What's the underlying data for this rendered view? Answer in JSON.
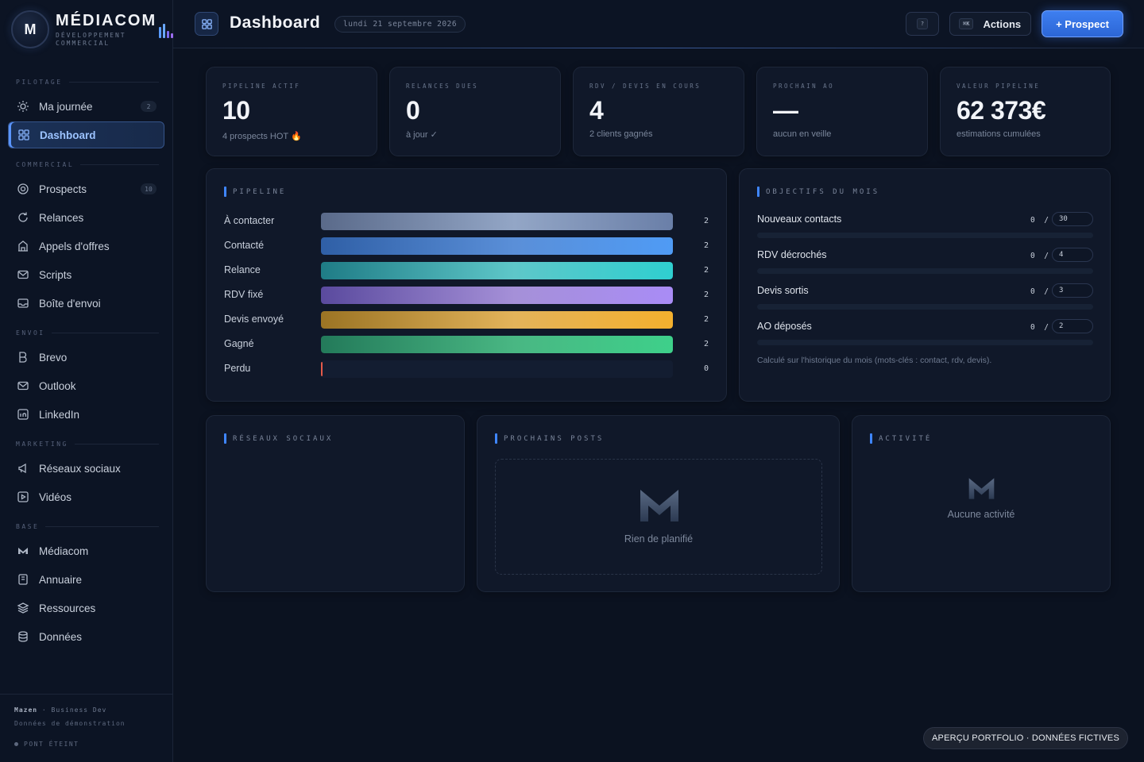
{
  "brand": {
    "logo_letter": "M",
    "name": "MÉDIACOM",
    "subtitle": "DÉVELOPPEMENT COMMERCIAL"
  },
  "sidebar": {
    "sections": [
      {
        "label": "PILOTAGE"
      },
      {
        "label": "COMMERCIAL"
      },
      {
        "label": "ENVOI"
      },
      {
        "label": "MARKETING"
      },
      {
        "label": "BASE"
      }
    ],
    "items": [
      {
        "label": "Ma journée",
        "icon": "sun-icon",
        "badge": "2"
      },
      {
        "label": "Dashboard",
        "icon": "grid-icon",
        "active": true
      },
      {
        "label": "Prospects",
        "icon": "target-icon",
        "badge": "10"
      },
      {
        "label": "Relances",
        "icon": "refresh-icon"
      },
      {
        "label": "Appels d'offres",
        "icon": "building-icon"
      },
      {
        "label": "Scripts",
        "icon": "mail-icon"
      },
      {
        "label": "Boîte d'envoi",
        "icon": "inbox-icon"
      },
      {
        "label": "Brevo",
        "icon": "brevo-icon"
      },
      {
        "label": "Outlook",
        "icon": "mail-icon"
      },
      {
        "label": "LinkedIn",
        "icon": "linkedin-icon"
      },
      {
        "label": "Réseaux sociaux",
        "icon": "megaphone-icon"
      },
      {
        "label": "Vidéos",
        "icon": "play-icon"
      },
      {
        "label": "Médiacom",
        "icon": "mediacom-icon"
      },
      {
        "label": "Annuaire",
        "icon": "book-icon"
      },
      {
        "label": "Ressources",
        "icon": "layers-icon"
      },
      {
        "label": "Données",
        "icon": "database-icon"
      }
    ],
    "footer": {
      "user": "Mazen",
      "role": "· Business Dev",
      "demo": "Données de démonstration",
      "status": "PONT ÉTEINT"
    }
  },
  "topbar": {
    "title": "Dashboard",
    "date": "lundi 21 septembre 2026",
    "help_key": "?",
    "actions_key": "⌘K",
    "actions_label": "Actions",
    "prospect_button": "+ Prospect"
  },
  "kpis": [
    {
      "label": "PIPELINE ACTIF",
      "value": "10",
      "sub": "4 prospects HOT 🔥"
    },
    {
      "label": "RELANCES DUES",
      "value": "0",
      "sub": "à jour ✓"
    },
    {
      "label": "RDV / DEVIS EN COURS",
      "value": "4",
      "sub": "2 clients gagnés"
    },
    {
      "label": "PROCHAIN AO",
      "value": "—",
      "sub": "aucun en veille"
    },
    {
      "label": "VALEUR PIPELINE",
      "value": "62 373€",
      "sub": "estimations cumulées"
    }
  ],
  "pipeline": {
    "title": "PIPELINE",
    "max": 2,
    "stages": [
      {
        "label": "À contacter",
        "count": 2,
        "color_from": "#5a6a8a",
        "color_mid": "#93a6c6",
        "color_to": "#6a7fa8"
      },
      {
        "label": "Contacté",
        "count": 2,
        "color_from": "#2f5fa6",
        "color_mid": "#5a8fd8",
        "color_to": "#4f9bf5"
      },
      {
        "label": "Relance",
        "count": 2,
        "color_from": "#1f7c86",
        "color_mid": "#5ec7c9",
        "color_to": "#2fcfd0"
      },
      {
        "label": "RDV fixé",
        "count": 2,
        "color_from": "#5a4a9e",
        "color_mid": "#a590d8",
        "color_to": "#a98cf6"
      },
      {
        "label": "Devis envoyé",
        "count": 2,
        "color_from": "#9b7424",
        "color_mid": "#e3b35a",
        "color_to": "#f4b02e"
      },
      {
        "label": "Gagné",
        "count": 2,
        "color_from": "#237a5a",
        "color_mid": "#49b783",
        "color_to": "#3ed08a"
      },
      {
        "label": "Perdu",
        "count": 0,
        "color_from": "#e55a4a",
        "color_mid": "#e55a4a",
        "color_to": "#e55a4a"
      }
    ]
  },
  "objectives": {
    "title": "OBJECTIFS DU MOIS",
    "items": [
      {
        "label": "Nouveaux contacts",
        "current": "0",
        "sep": "/",
        "target": "30",
        "progress": 0
      },
      {
        "label": "RDV décrochés",
        "current": "0",
        "sep": "/",
        "target": "4",
        "progress": 0
      },
      {
        "label": "Devis sortis",
        "current": "0",
        "sep": "/",
        "target": "3",
        "progress": 0
      },
      {
        "label": "AO déposés",
        "current": "0",
        "sep": "/",
        "target": "2",
        "progress": 0
      }
    ],
    "note": "Calculé sur l'historique du mois (mots-clés : contact, rdv, devis)."
  },
  "social": {
    "title": "RÉSEAUX SOCIAUX"
  },
  "posts": {
    "title": "PROCHAINS POSTS",
    "empty": "Rien de planifié"
  },
  "activity": {
    "title": "ACTIVITÉ",
    "empty": "Aucune activité"
  },
  "toast": "APERÇU PORTFOLIO · DONNÉES FICTIVES"
}
